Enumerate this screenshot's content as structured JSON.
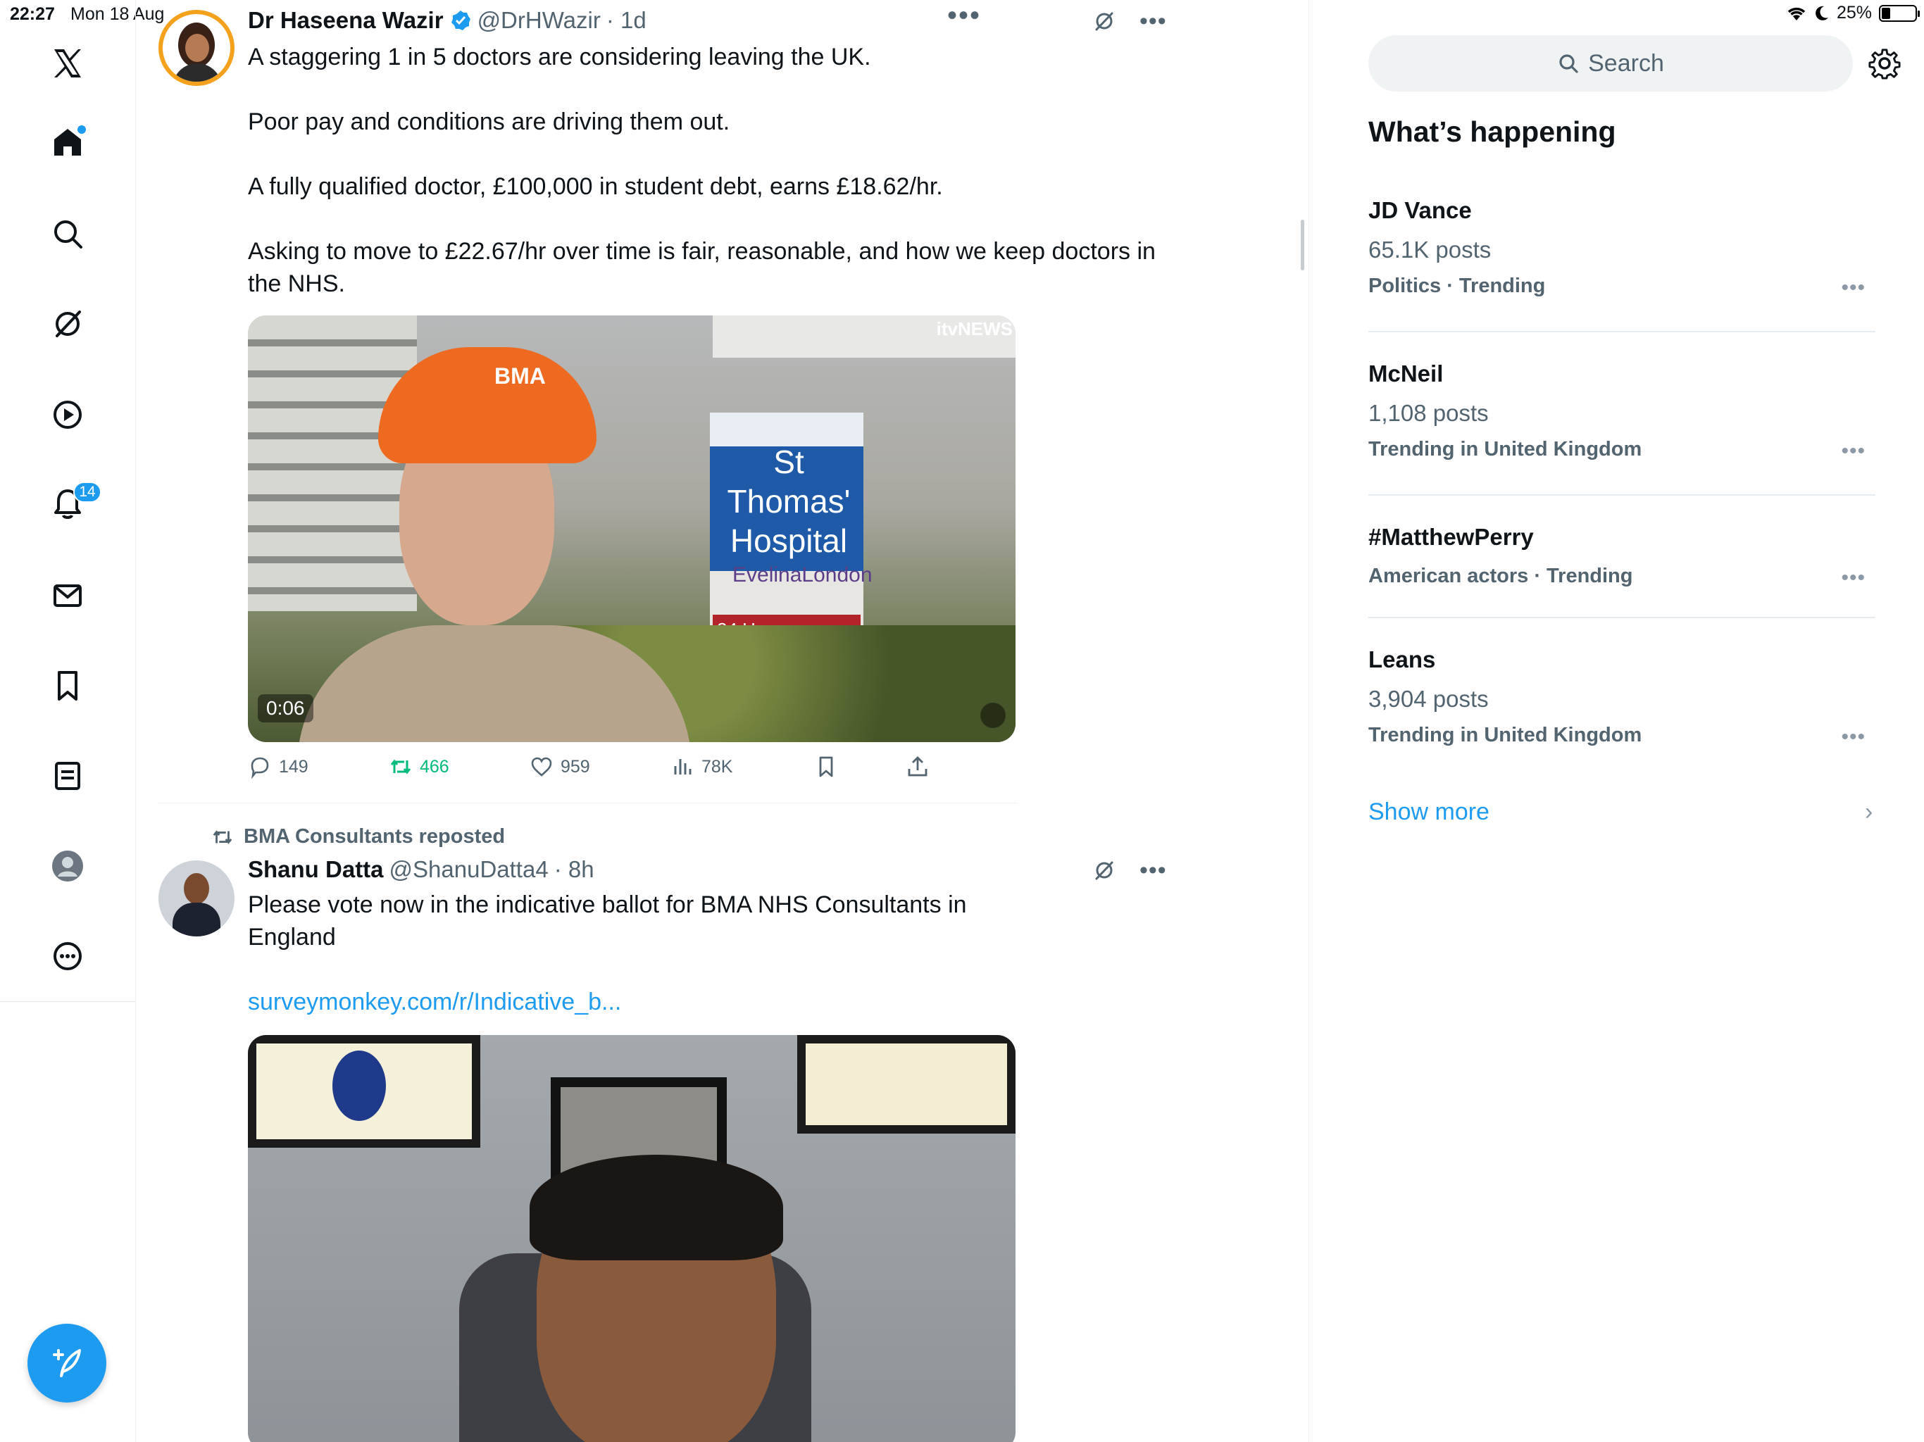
{
  "status_bar": {
    "time": "22:27",
    "date": "Mon 18 Aug",
    "battery": "25%",
    "battery_level": 0.25
  },
  "left_nav": {
    "notifications_badge": "14",
    "items": [
      "x-logo",
      "home",
      "search",
      "grok",
      "video",
      "notifications",
      "messages",
      "bookmarks",
      "lists",
      "profile",
      "more"
    ]
  },
  "tweet1": {
    "name": "Dr Haseena Wazir",
    "handle": "@DrHWazir",
    "time": "· 1d",
    "paragraphs": [
      "A staggering 1 in 5 doctors are considering leaving the UK.",
      "Poor pay and conditions are driving them out.",
      "A fully qualified doctor, £100,000 in student debt, earns £18.62/hr.",
      "Asking to move to £22.67/hr over time is fair, reasonable, and how we keep doctors in the NHS."
    ],
    "media": {
      "duration": "0:06",
      "network_logo": "itvNEWS",
      "cap_text": "BMA",
      "sign_lines": [
        "St Thomas'",
        "Hospital"
      ],
      "sign_sub": "EvelinaLondon",
      "sign_emergency": "24 Hour Emergency"
    },
    "actions": {
      "replies": "149",
      "reposts": "466",
      "likes": "959",
      "views": "78K"
    }
  },
  "tweet2": {
    "reposted_by": "BMA Consultants reposted",
    "name": "Shanu Datta",
    "handle": "@ShanuDatta4",
    "time": "· 8h",
    "text": "Please vote now in the indicative ballot for BMA NHS Consultants in England",
    "link": "surveymonkey.com/r/Indicative_b..."
  },
  "sidebar": {
    "search_placeholder": "Search",
    "heading": "What’s happening",
    "trends": [
      {
        "name": "JD Vance",
        "posts": "65.1K posts",
        "category": "Politics · Trending"
      },
      {
        "name": "McNeil",
        "posts": "1,108 posts",
        "category": "Trending in United Kingdom"
      },
      {
        "name": "#MatthewPerry",
        "posts": "",
        "category": "American actors · Trending"
      },
      {
        "name": "Leans",
        "posts": "3,904 posts",
        "category": "Trending in United Kingdom"
      }
    ],
    "show_more": "Show more"
  },
  "colors": {
    "accent": "#1d9bf0",
    "repost_green": "#00ba7c",
    "muted_text": "#536471"
  }
}
